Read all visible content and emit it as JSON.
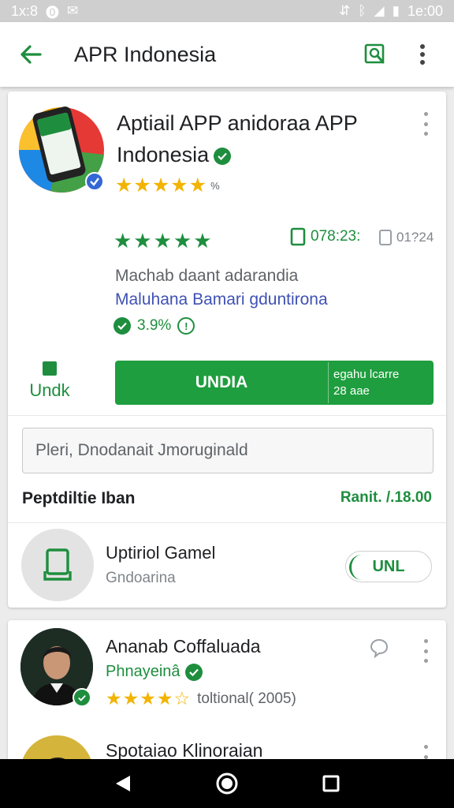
{
  "status_bar": {
    "time_left": "1x:8",
    "time_right": "1e:00"
  },
  "app_bar": {
    "title": "APR Indonesia"
  },
  "app": {
    "name_line1": "Aptiail APP anidoraa APP",
    "name_line2": "Indonesia",
    "rating_text": "%",
    "green_stars": "★★★★★",
    "stat_a": "078:23:",
    "stat_b": "01?24",
    "desc_line1": "Machab daant adarandia",
    "desc_line2": "Maluhana Bamari gduntirona",
    "score": "3.9%",
    "side_action_label": "Undk",
    "install_label": "UNDIA",
    "install_side_line1": "egahu lcarre",
    "install_side_line2": "28 aae"
  },
  "search": {
    "value": "Pleri, Dnodanait Jmoruginald"
  },
  "section": {
    "title": "Peptdiltie Iban",
    "value": "Ranit. /.18.00"
  },
  "update": {
    "title": "Uptiriol Gamel",
    "subtitle": "Gndoarina",
    "button_label": "UNL"
  },
  "reviews": [
    {
      "name": "Ananab Coffaluada",
      "subtitle": "Phnayeinâ",
      "rating_text": "toltional( 2005)"
    },
    {
      "name": "Spotaiao Klinoraian"
    }
  ],
  "colors": {
    "accent": "#1e8e3e",
    "star": "#f2b400",
    "link": "#3f51b5"
  }
}
